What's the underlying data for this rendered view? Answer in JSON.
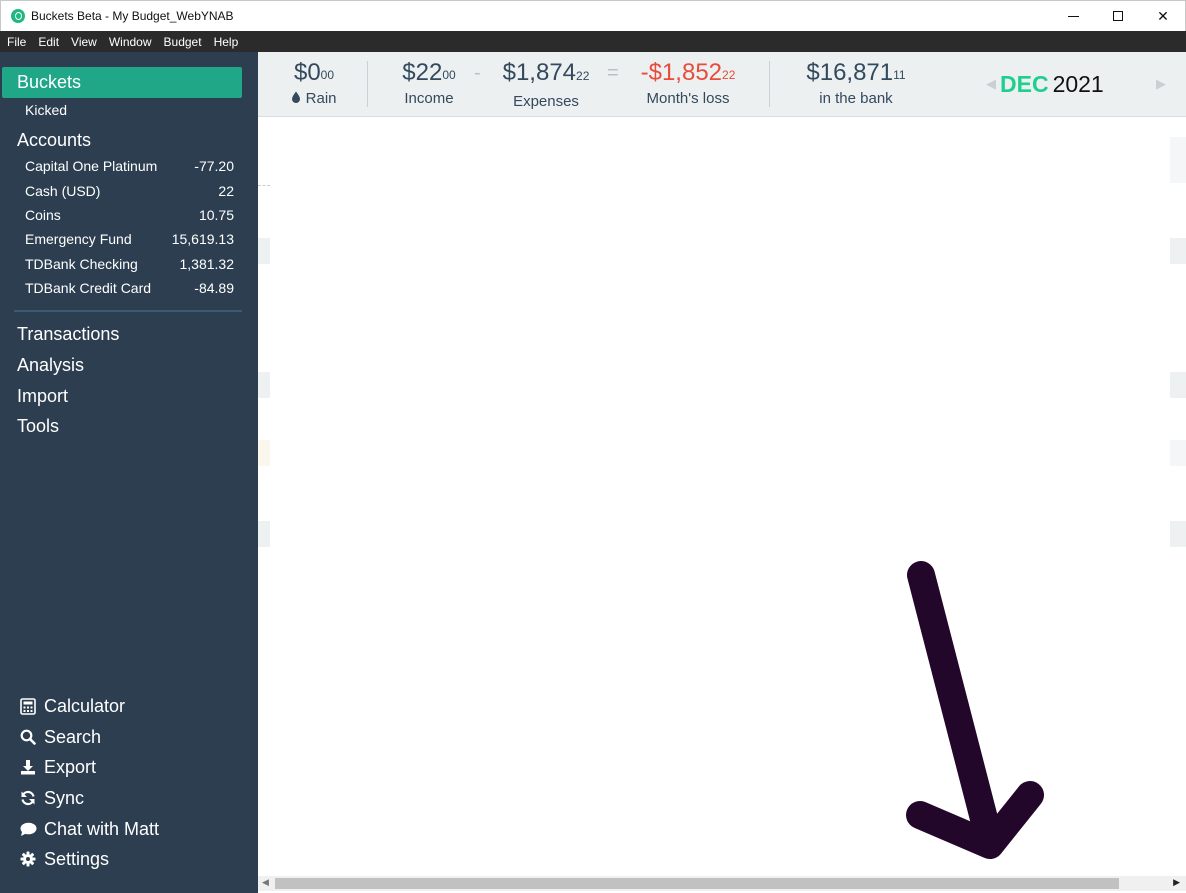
{
  "window": {
    "title": "Buckets Beta - My Budget_WebYNAB",
    "minimize_label": "",
    "maximize_label": "",
    "close_label": "✕"
  },
  "menu": [
    "File",
    "Edit",
    "View",
    "Window",
    "Budget",
    "Help"
  ],
  "sidebar": {
    "buckets": "Buckets",
    "kicked": "Kicked",
    "accounts_header": "Accounts",
    "accounts": [
      {
        "name": "Capital One Platinum",
        "balance": "-77.20"
      },
      {
        "name": "Cash (USD)",
        "balance": "22"
      },
      {
        "name": "Coins",
        "balance": "10.75"
      },
      {
        "name": "Emergency Fund",
        "balance": "15,619.13"
      },
      {
        "name": "TDBank Checking",
        "balance": "1,381.32"
      },
      {
        "name": "TDBank Credit Card",
        "balance": "-84.89"
      }
    ],
    "nav": [
      "Transactions",
      "Analysis",
      "Import",
      "Tools"
    ],
    "tools": [
      {
        "label": "Calculator",
        "icon": "calculator-icon"
      },
      {
        "label": "Search",
        "icon": "search-icon"
      },
      {
        "label": "Export",
        "icon": "download-icon"
      },
      {
        "label": "Sync",
        "icon": "sync-icon"
      },
      {
        "label": "Chat with Matt",
        "icon": "chat-icon"
      },
      {
        "label": "Settings",
        "icon": "gear-icon"
      }
    ]
  },
  "summary": {
    "rain": {
      "whole": "$0",
      "cents": "00",
      "label": "Rain"
    },
    "income": {
      "whole": "$22",
      "cents": "00",
      "label": "Income"
    },
    "minus": "-",
    "expenses": {
      "whole": "$1,874",
      "cents": "22",
      "label": "Expenses"
    },
    "equals": "=",
    "loss": {
      "whole": "-$1,852",
      "cents": "22",
      "label": "Month's loss"
    },
    "bank": {
      "whole": "$16,871",
      "cents": "11",
      "label": "in the bank"
    }
  },
  "month_nav": {
    "prev": "◀",
    "month": "DEC",
    "year": "2021",
    "next": "▶"
  },
  "colors": {
    "sidebar_bg": "#2c3e50",
    "accent": "#1fa788",
    "month_green": "#1fcf8e",
    "loss_red": "#e74c3c",
    "header_bg": "#ecf0f1",
    "annotation_arrow": "#22072a"
  },
  "scrollbar": {
    "left": "◀",
    "right": "▶"
  }
}
